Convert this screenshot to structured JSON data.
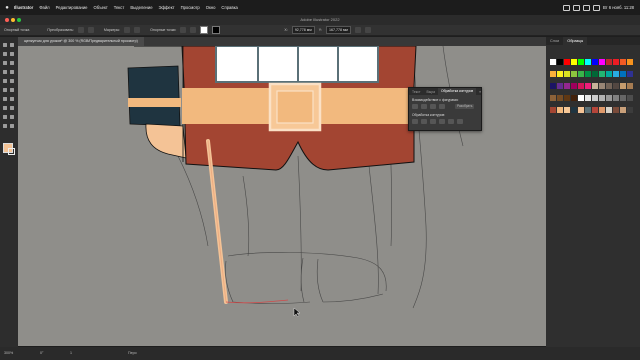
{
  "menubar": {
    "app": "Illustrator",
    "items": [
      "Файл",
      "Редактирование",
      "Объект",
      "Текст",
      "Выделение",
      "Эффект",
      "Просмотр",
      "Окно",
      "Справка"
    ],
    "clock": "Вт 6 нояб. 11:28"
  },
  "window": {
    "title": "Adobe Illustrator 2022"
  },
  "controlbar": {
    "selection": "Опорный точка",
    "convert_label": "Преобразовать:",
    "handles_label": "Маркеры:",
    "anchors_label": "Опорные точки:",
    "x_value": "92,778 мм",
    "y_value": "167,778 мм"
  },
  "document_tab": {
    "label": "щелкунчик для уроков* @ 300 % (RGB/Предварительный просмотр)"
  },
  "right_panel": {
    "tabs": [
      "Слои",
      "Образцы"
    ],
    "active_tab": "Образцы"
  },
  "pathfinder": {
    "tabs": [
      "Текст",
      "Выра",
      "Обработка контуров"
    ],
    "active_tab": "Обработка контуров",
    "shape_modes_label": "Взаимодействие с фигурами:",
    "expand_label": "Разобрать",
    "pathfinders_label": "Обработка контуров:"
  },
  "statusbar": {
    "zoom": "300%",
    "angle": "0°",
    "page": "1",
    "tool": "Перо"
  },
  "colors": {
    "artboard": "#8f8e8a",
    "paper": "#9a9894",
    "coat_red": "#a34532",
    "belt": "#f2b97e",
    "belt_light": "#f7c897",
    "cuff_dark": "#1f3440",
    "skin": "#f4c396",
    "white_panel": "#ffffff",
    "panel_frame": "#5a7077",
    "sketch_line": "#3c3c3c"
  },
  "swatches": [
    [
      "#ffffff",
      "#000000",
      "#ff0000",
      "#ffff00",
      "#00ff00",
      "#00ffff",
      "#0000ff",
      "#ff00ff",
      "#c1272d",
      "#ed1c24",
      "#f15a24",
      "#f7931e"
    ],
    [
      "#fbb03b",
      "#fcee21",
      "#d9e021",
      "#8cc63f",
      "#39b54a",
      "#009245",
      "#006837",
      "#22b573",
      "#00a99d",
      "#29abe2",
      "#0071bc",
      "#2e3192"
    ],
    [
      "#1b1464",
      "#662d91",
      "#93278f",
      "#9e005d",
      "#d4145a",
      "#ed1e79",
      "#c7b299",
      "#998675",
      "#736357",
      "#534741",
      "#c69c6d",
      "#a67c52"
    ],
    [
      "#8c6239",
      "#754c24",
      "#603813",
      "#42210b",
      "#ffffff",
      "#e6e6e6",
      "#cccccc",
      "#b3b3b3",
      "#999999",
      "#808080",
      "#666666",
      "#4d4d4d"
    ],
    [
      "#a34532",
      "#f2b97e",
      "#f7c897",
      "#1f3440",
      "#f4c396",
      "#5a7077",
      "#b5453a",
      "#e09a6b",
      "#d8d2c8",
      "#7a4b3a",
      "#c9a07a",
      "#3c3c3c"
    ]
  ]
}
